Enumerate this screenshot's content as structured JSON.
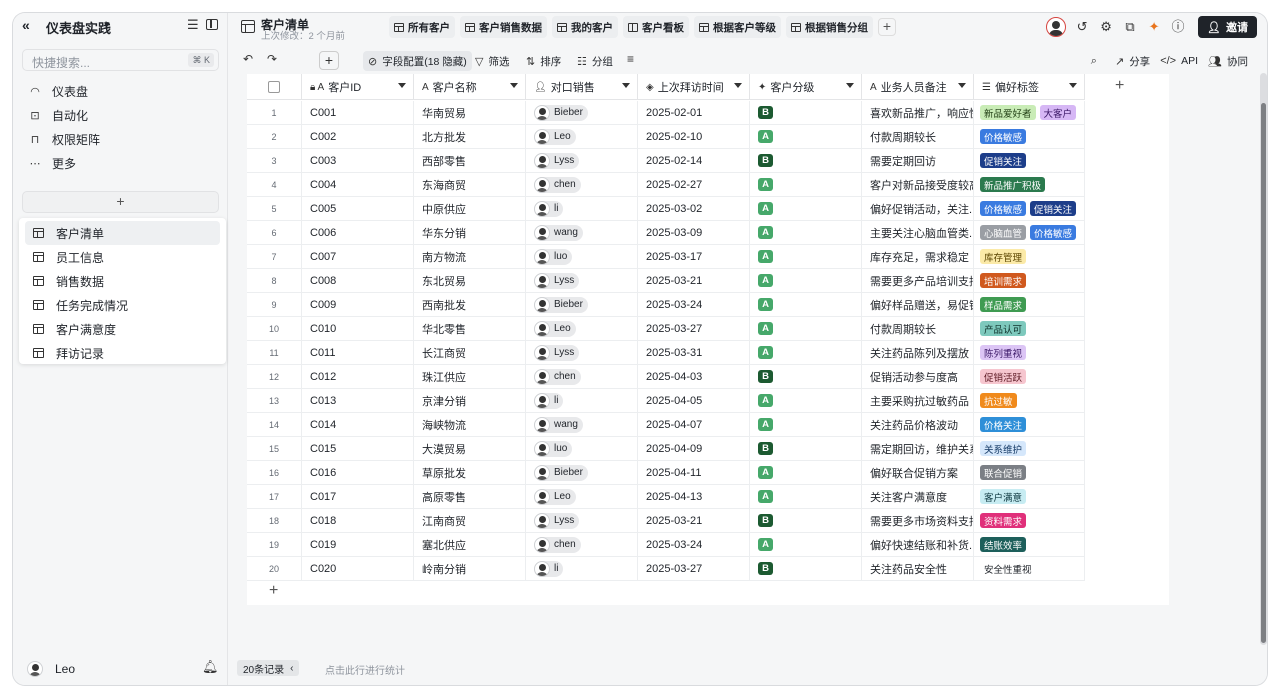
{
  "sidebar": {
    "title": "仪表盘实践",
    "search_placeholder": "快捷搜索...",
    "search_shortcut": "⌘ K",
    "nav": [
      {
        "label": "仪表盘",
        "icon": "gauge-icon"
      },
      {
        "label": "自动化",
        "icon": "robot-icon"
      },
      {
        "label": "权限矩阵",
        "icon": "lock-icon"
      },
      {
        "label": "更多",
        "icon": "more-icon"
      }
    ],
    "add_label": "+",
    "pages": [
      {
        "label": "客户清单",
        "active": true
      },
      {
        "label": "员工信息"
      },
      {
        "label": "销售数据"
      },
      {
        "label": "任务完成情况"
      },
      {
        "label": "客户满意度"
      },
      {
        "label": "拜访记录"
      }
    ],
    "user": "Leo"
  },
  "header": {
    "title": "客户清单",
    "subtitle": "上次修改：2 个月前",
    "view_tabs": [
      "所有客户",
      "客户销售数据",
      "我的客户",
      "客户看板",
      "根据客户等级",
      "根据销售分组"
    ],
    "invite_label": "邀请"
  },
  "toolbar": {
    "field_config": "字段配置(18 隐藏)",
    "filter": "筛选",
    "sort": "排序",
    "group": "分组",
    "share": "分享",
    "api": "API",
    "collab": "协同"
  },
  "columns": [
    "客户ID",
    "客户名称",
    "对口销售",
    "上次拜访时间",
    "客户分级",
    "业务人员备注",
    "偏好标签"
  ],
  "rows": [
    {
      "n": "1",
      "id": "C001",
      "name": "华南贸易",
      "sales": "Bieber",
      "date": "2025-02-01",
      "grade": "B",
      "note": "喜欢新品推广，响应快",
      "tags": [
        {
          "t": "新品爱好者",
          "bg": "#c9ecb6",
          "fg": "#1f3d12"
        },
        {
          "t": "大客户",
          "bg": "#d6b7f5",
          "fg": "#3a1766"
        }
      ]
    },
    {
      "n": "2",
      "id": "C002",
      "name": "北方批发",
      "sales": "Leo",
      "date": "2025-02-10",
      "grade": "A",
      "note": "付款周期较长",
      "tags": [
        {
          "t": "价格敏感",
          "bg": "#3a7be0",
          "fg": "#ffffff"
        }
      ]
    },
    {
      "n": "3",
      "id": "C003",
      "name": "西部零售",
      "sales": "Lyss",
      "date": "2025-02-14",
      "grade": "B",
      "note": "需要定期回访",
      "tags": [
        {
          "t": "促销关注",
          "bg": "#1d3e8a",
          "fg": "#ffffff"
        }
      ]
    },
    {
      "n": "4",
      "id": "C004",
      "name": "东海商贸",
      "sales": "chen",
      "date": "2025-02-27",
      "grade": "A",
      "note": "客户对新品接受度较高",
      "tags": [
        {
          "t": "新品推广积极",
          "bg": "#2b7a4e",
          "fg": "#ffffff"
        }
      ]
    },
    {
      "n": "5",
      "id": "C005",
      "name": "中原供应",
      "sales": "li",
      "date": "2025-03-02",
      "grade": "A",
      "note": "偏好促销活动，关注...",
      "tags": [
        {
          "t": "价格敏感",
          "bg": "#3a7be0",
          "fg": "#ffffff"
        },
        {
          "t": "促销关注",
          "bg": "#1d3e8a",
          "fg": "#ffffff"
        }
      ]
    },
    {
      "n": "6",
      "id": "C006",
      "name": "华东分销",
      "sales": "wang",
      "date": "2025-03-09",
      "grade": "A",
      "note": "主要关注心脑血管类...",
      "tags": [
        {
          "t": "心脑血管",
          "bg": "#9a9ea4",
          "fg": "#ffffff"
        },
        {
          "t": "价格敏感",
          "bg": "#3a7be0",
          "fg": "#ffffff"
        }
      ]
    },
    {
      "n": "7",
      "id": "C007",
      "name": "南方物流",
      "sales": "luo",
      "date": "2025-03-17",
      "grade": "A",
      "note": "库存充足，需求稳定",
      "tags": [
        {
          "t": "库存管理",
          "bg": "#fbeaa8",
          "fg": "#5b4500"
        }
      ]
    },
    {
      "n": "8",
      "id": "C008",
      "name": "东北贸易",
      "sales": "Lyss",
      "date": "2025-03-21",
      "grade": "A",
      "note": "需要更多产品培训支持",
      "tags": [
        {
          "t": "培训需求",
          "bg": "#d0591e",
          "fg": "#ffffff"
        }
      ]
    },
    {
      "n": "9",
      "id": "C009",
      "name": "西南批发",
      "sales": "Bieber",
      "date": "2025-03-24",
      "grade": "A",
      "note": "偏好样品赠送，易促销",
      "tags": [
        {
          "t": "样品需求",
          "bg": "#3f9b52",
          "fg": "#ffffff"
        }
      ]
    },
    {
      "n": "10",
      "id": "C010",
      "name": "华北零售",
      "sales": "Leo",
      "date": "2025-03-27",
      "grade": "A",
      "note": "付款周期较长",
      "tags": [
        {
          "t": "产品认可",
          "bg": "#7ec9bd",
          "fg": "#10332d"
        }
      ]
    },
    {
      "n": "11",
      "id": "C011",
      "name": "长江商贸",
      "sales": "Lyss",
      "date": "2025-03-31",
      "grade": "A",
      "note": "关注药品陈列及摆放",
      "tags": [
        {
          "t": "陈列重视",
          "bg": "#dcc5f5",
          "fg": "#3a1766"
        }
      ]
    },
    {
      "n": "12",
      "id": "C012",
      "name": "珠江供应",
      "sales": "chen",
      "date": "2025-04-03",
      "grade": "B",
      "note": "促销活动参与度高",
      "tags": [
        {
          "t": "促销活跃",
          "bg": "#f6c6cf",
          "fg": "#5a1620"
        }
      ]
    },
    {
      "n": "13",
      "id": "C013",
      "name": "京津分销",
      "sales": "li",
      "date": "2025-04-05",
      "grade": "A",
      "note": "主要采购抗过敏药品",
      "tags": [
        {
          "t": "抗过敏",
          "bg": "#f08a1c",
          "fg": "#ffffff"
        }
      ]
    },
    {
      "n": "14",
      "id": "C014",
      "name": "海峡物流",
      "sales": "wang",
      "date": "2025-04-07",
      "grade": "A",
      "note": "关注药品价格波动",
      "tags": [
        {
          "t": "价格关注",
          "bg": "#2e8fd8",
          "fg": "#ffffff"
        }
      ]
    },
    {
      "n": "15",
      "id": "C015",
      "name": "大漠贸易",
      "sales": "luo",
      "date": "2025-04-09",
      "grade": "B",
      "note": "需定期回访，维护关系",
      "tags": [
        {
          "t": "关系维护",
          "bg": "#d5e7fb",
          "fg": "#153a66"
        }
      ]
    },
    {
      "n": "16",
      "id": "C016",
      "name": "草原批发",
      "sales": "Bieber",
      "date": "2025-04-11",
      "grade": "A",
      "note": "偏好联合促销方案",
      "tags": [
        {
          "t": "联合促销",
          "bg": "#7b7f85",
          "fg": "#ffffff"
        }
      ]
    },
    {
      "n": "17",
      "id": "C017",
      "name": "高原零售",
      "sales": "Leo",
      "date": "2025-04-13",
      "grade": "A",
      "note": "关注客户满意度",
      "tags": [
        {
          "t": "客户满意",
          "bg": "#c7ecf2",
          "fg": "#0f3a42"
        }
      ]
    },
    {
      "n": "18",
      "id": "C018",
      "name": "江南商贸",
      "sales": "Lyss",
      "date": "2025-03-21",
      "grade": "B",
      "note": "需要更多市场资料支持",
      "tags": [
        {
          "t": "资料需求",
          "bg": "#e0307a",
          "fg": "#ffffff"
        }
      ]
    },
    {
      "n": "19",
      "id": "C019",
      "name": "塞北供应",
      "sales": "chen",
      "date": "2025-03-24",
      "grade": "A",
      "note": "偏好快速结账和补货...",
      "tags": [
        {
          "t": "结账效率",
          "bg": "#1d5f5b",
          "fg": "#ffffff"
        }
      ]
    },
    {
      "n": "20",
      "id": "C020",
      "name": "岭南分销",
      "sales": "li",
      "date": "2025-03-27",
      "grade": "B",
      "note": "关注药品安全性",
      "tags": [
        {
          "t": "安全性重视",
          "bg": "#ffffff",
          "fg": "#1f2329"
        }
      ]
    }
  ],
  "footer": {
    "record_count": "20条记录",
    "stat_hint": "点击此行进行统计"
  },
  "colors": {
    "accent_dark": "#1f2329",
    "grade_a": "#46a86a",
    "grade_b": "#1c5a31"
  }
}
